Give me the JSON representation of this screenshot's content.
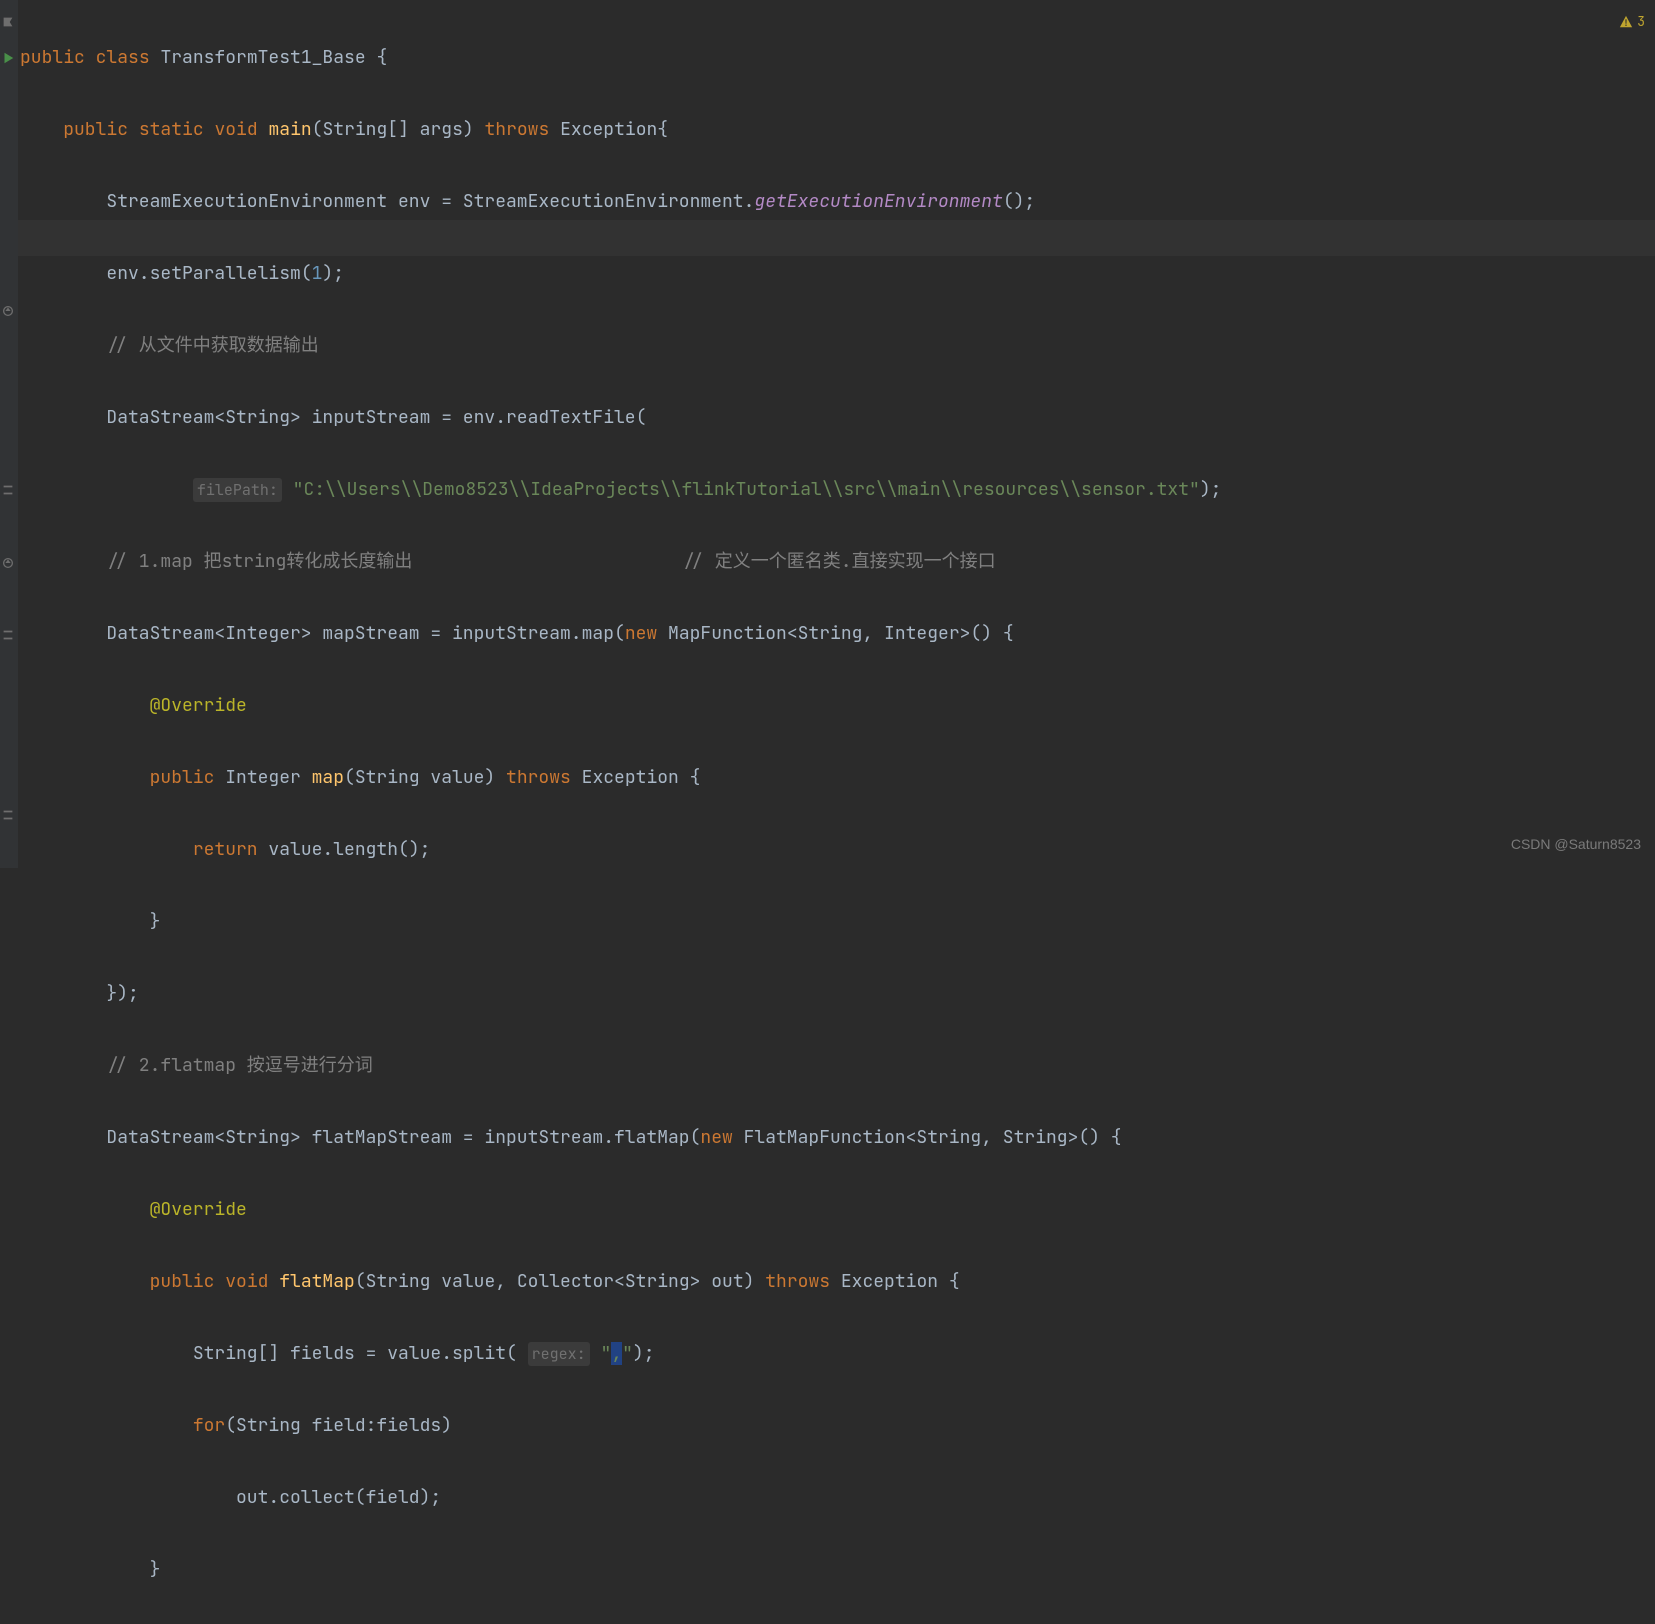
{
  "warning": {
    "count": "3"
  },
  "watermark": "CSDN @Saturn8523",
  "code": {
    "l1": {
      "public": "public",
      "class": "class",
      "name": "TransformTest1_Base",
      "brace": " {"
    },
    "l2": {
      "public": "public",
      "static": "static",
      "void": "void",
      "main": "main",
      "params": "(String[] args)",
      "throws": "throws",
      "exc": "Exception{"
    },
    "l3": {
      "t1": "StreamExecutionEnvironment env = StreamExecutionEnvironment.",
      "call": "getExecutionEnvironment",
      "t2": "();"
    },
    "l4": {
      "t1": "env.setParallelism(",
      "num": "1",
      "t2": ");"
    },
    "l5": {
      "c": "// 从文件中获取数据输出"
    },
    "l6": {
      "t1": "DataStream<String> inputStream = env.readTextFile("
    },
    "l7": {
      "hint": "filePath:",
      "str": "\"C:\\\\Users\\\\Demo8523\\\\IdeaProjects\\\\flinkTutorial\\\\src\\\\main\\\\resources\\\\sensor.txt\"",
      "t2": ");"
    },
    "l8": {
      "c1": "// 1.map 把string转化成长度输出",
      "c2": "// 定义一个匿名类.直接实现一个接口"
    },
    "l9": {
      "t1": "DataStream<Integer> mapStream = inputStream.map(",
      "new": "new",
      "t2": " MapFunction<String, Integer>() {"
    },
    "l10": {
      "ann": "@Override"
    },
    "l11": {
      "public": "public",
      "type": " Integer ",
      "method": "map",
      "params": "(String value) ",
      "throws": "throws",
      "exc": " Exception {"
    },
    "l12": {
      "ret": "return",
      "t": " value.length();"
    },
    "l13": {
      "t": "}"
    },
    "l14": {
      "t": "});"
    },
    "l15": {
      "c": "// 2.flatmap 按逗号进行分词"
    },
    "l16": {
      "t1": "DataStream<String> flatMapStream = inputStream.flatMap(",
      "new": "new",
      "t2": " FlatMapFunction<String, String>() {"
    },
    "l17": {
      "ann": "@Override"
    },
    "l18": {
      "public": "public",
      "void": " void ",
      "method": "flatMap",
      "params": "(String value, Collector<String> out) ",
      "throws": "throws",
      "exc": " Exception {"
    },
    "l19": {
      "t1": "String[] fields = value.split( ",
      "hint": "regex:",
      "sp": " ",
      "q1": "\"",
      "comma": ",",
      "q2": "\"",
      "t2": ");"
    },
    "l20": {
      "kw": "for",
      "t": "(String field:fields)"
    },
    "l21": {
      "t": "out.collect(field);"
    },
    "l22": {
      "t": "}"
    }
  }
}
